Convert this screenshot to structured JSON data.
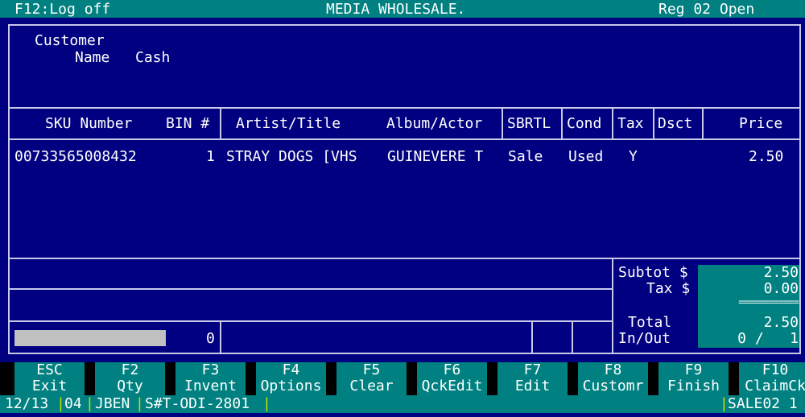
{
  "titlebar": {
    "left": "F12:Log off",
    "center": "MEDIA WHOLESALE.",
    "right": "Reg 02 Open"
  },
  "customer": {
    "label": "Customer",
    "name_label": "Name",
    "name_value": "Cash"
  },
  "table": {
    "columns": [
      "SKU Number",
      "BIN #",
      "Artist/Title",
      "Album/Actor",
      "SBRTL",
      "Cond",
      "Tax",
      "Dsct",
      "Price"
    ],
    "rows": [
      {
        "sku": "00733565008432",
        "bin": "1",
        "artist": "STRAY DOGS [VHS",
        "album": "GUINEVERE T",
        "sbrtl": "Sale",
        "cond": "Used",
        "tax": "Y",
        "dsct": "",
        "price": "2.50"
      }
    ]
  },
  "progress": {
    "value": "0"
  },
  "totals": {
    "subtot_label": "Subtot $",
    "subtot": "2.50",
    "tax_label": "Tax $",
    "tax": "0.00",
    "rule": "============",
    "total_label": "Total",
    "total": "2.50",
    "inout_label": "In/Out",
    "inout": "0 /   1"
  },
  "fkeys": [
    {
      "key": "ESC",
      "label": "Exit"
    },
    {
      "key": "F2",
      "label": "Qty"
    },
    {
      "key": "F3",
      "label": "Invent"
    },
    {
      "key": "F4",
      "label": "Options"
    },
    {
      "key": "F5",
      "label": "Clear"
    },
    {
      "key": "F6",
      "label": "QckEdit"
    },
    {
      "key": "F7",
      "label": "Edit"
    },
    {
      "key": "F8",
      "label": "Customr"
    },
    {
      "key": "F9",
      "label": "Finish"
    },
    {
      "key": "F10",
      "label": "ClaimCk"
    }
  ],
  "status": {
    "date": "12/13",
    "reg": "04",
    "user": "JBEN",
    "store": "S#T-ODI-2801",
    "mode": "SALE02 1"
  },
  "colors": {
    "background": "#000080",
    "accent": "#008080",
    "text": "#ffffff"
  }
}
